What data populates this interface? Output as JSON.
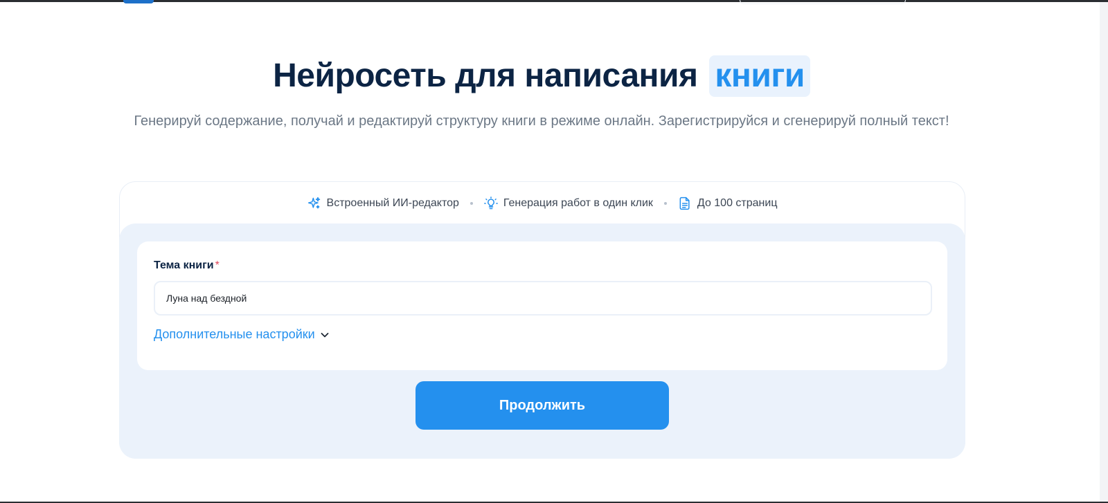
{
  "hero": {
    "title_main": "Нейросеть для написания",
    "title_accent": "книги",
    "subtitle": "Генерируй содержание, получай и редактируй структуру книги в режиме онлайн. Зарегистрируйся и сгенерируй полный текст!"
  },
  "features": [
    {
      "icon": "sparkles-icon",
      "label": "Встроенный ИИ-редактор"
    },
    {
      "icon": "lightbulb-icon",
      "label": "Генерация работ в один клик"
    },
    {
      "icon": "document-icon",
      "label": "До 100 страниц"
    }
  ],
  "form": {
    "topic_label": "Тема книги",
    "required_mark": "*",
    "topic_value": "Луна над бездной",
    "more_settings_label": "Дополнительные настройки",
    "continue_label": "Продолжить"
  },
  "colors": {
    "accent": "#2490ee",
    "title": "#0c2444",
    "panel_bg": "#ebf2fb"
  }
}
